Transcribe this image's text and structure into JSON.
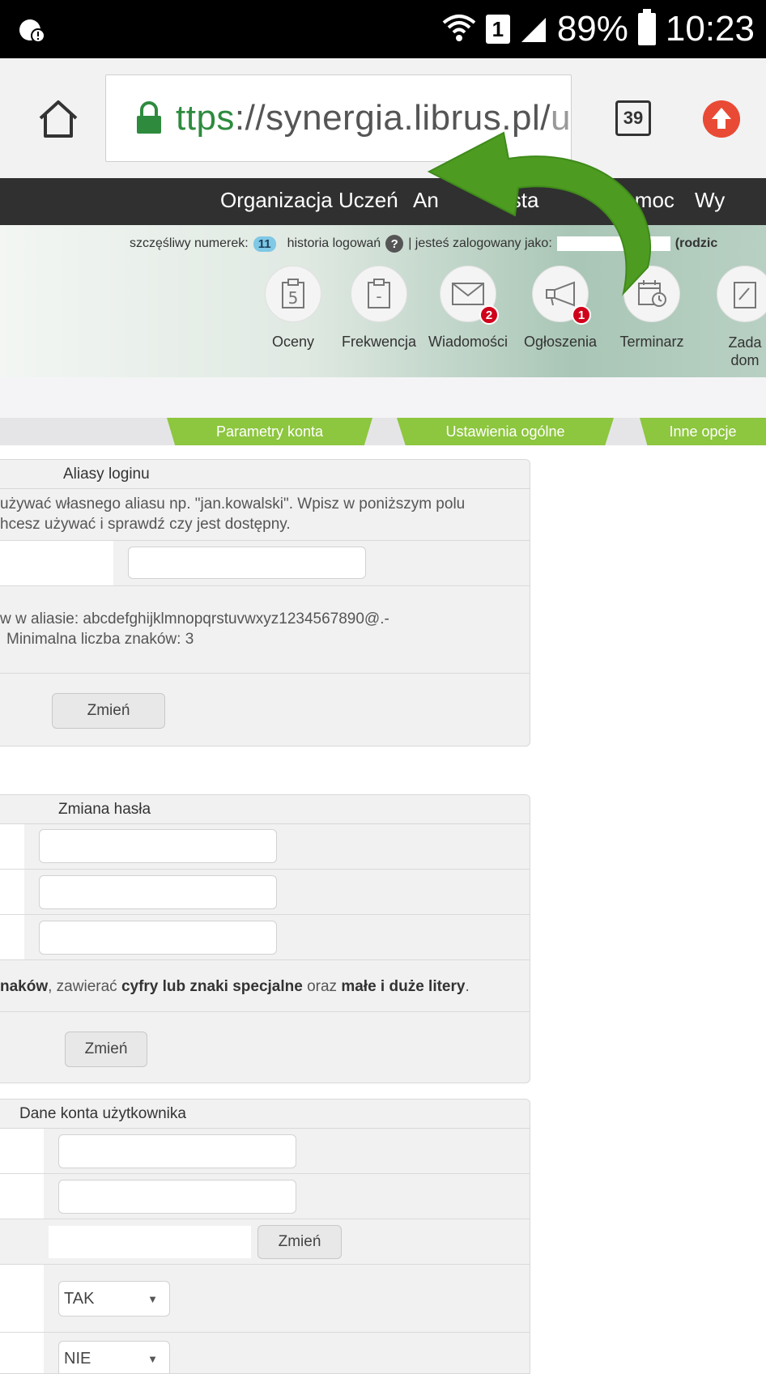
{
  "status_bar": {
    "battery": "89%",
    "time": "10:23",
    "sim": "1"
  },
  "browser": {
    "url_scheme": "ttps",
    "url_rest": "://synergia.librus.pl/",
    "url_tail": "u",
    "tabs_count": "39"
  },
  "topnav": {
    "items": [
      "Organizacja",
      "Uczeń",
      "An",
      "Usta",
      "Pomoc",
      "Wy"
    ]
  },
  "infobar": {
    "lucky_label": "szczęśliwy numerek:",
    "lucky_number": "11",
    "history": "historia logowań",
    "help": "?",
    "logged_as": "| jesteś zalogowany jako:",
    "role": "(rodzic"
  },
  "shortcuts": [
    {
      "label": "Oceny",
      "glyph": "5",
      "icon": "grades-icon"
    },
    {
      "label": "Frekwencja",
      "glyph": "-",
      "icon": "attendance-icon"
    },
    {
      "label": "Wiadomości",
      "badge": "2",
      "icon": "envelope-icon"
    },
    {
      "label": "Ogłoszenia",
      "badge": "1",
      "icon": "megaphone-icon"
    },
    {
      "label": "Terminarz",
      "icon": "calendar-icon"
    },
    {
      "label": "Zada",
      "label2": "dom",
      "icon": "homework-icon"
    }
  ],
  "tabs": [
    "Parametry konta",
    "Ustawienia ogólne",
    "Inne opcje"
  ],
  "aliases": {
    "title": "Aliasy loginu",
    "desc1": "używać własnego aliasu np. \"jan.kowalski\". Wpisz w poniższym polu",
    "desc2": "hcesz używać i sprawdź czy jest dostępny.",
    "rules1": "w w aliasie: abcdefghijklmnopqrstuvwxyz1234567890@.-",
    "rules2": "Minimalna liczba znaków: 3",
    "button": "Zmień"
  },
  "password": {
    "title": "Zmiana hasła",
    "hint_a": "naków",
    "hint_b": ", zawierać ",
    "hint_c": "cyfry lub znaki specjalne",
    "hint_d": " oraz ",
    "hint_e": "małe i duże litery",
    "hint_f": ".",
    "button": "Zmień"
  },
  "account": {
    "title": "Dane konta użytkownika",
    "change_button": "Zmień",
    "select1": "TAK",
    "select2": "NIE"
  },
  "colors": {
    "accent_green": "#8dc63f",
    "nav_bg": "#303030",
    "badge_red": "#d0021b",
    "arrow_green": "#4e9b22"
  }
}
